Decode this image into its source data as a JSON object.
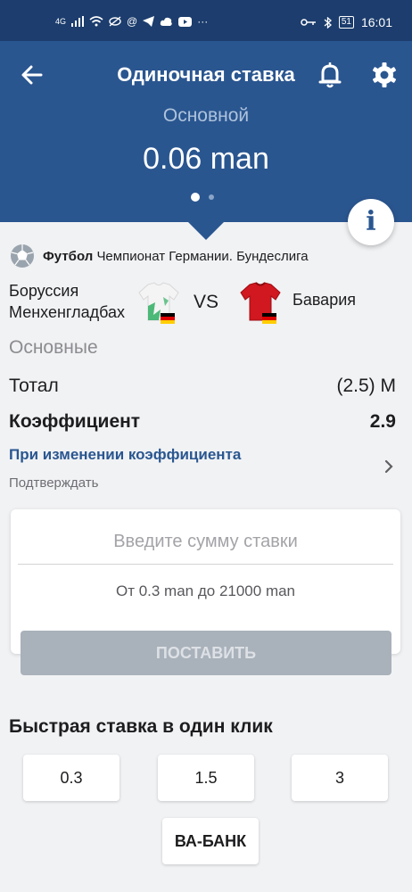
{
  "statusbar": {
    "left_icons": [
      "network-4g-icon",
      "wifi-icon",
      "eye-off-icon",
      "at-icon",
      "telegram-icon",
      "cloud-icon",
      "youtube-icon",
      "more-dots"
    ],
    "network_label": "4G",
    "battery": "51",
    "time": "16:01"
  },
  "header": {
    "title": "Одиночная ставка",
    "subtitle": "Основной",
    "amount": "0.06 man"
  },
  "event": {
    "sport": "Футбол",
    "league": "Чемпионат Германии. Бундеслига",
    "team1": "Боруссия Менхенгладбах",
    "vs": "VS",
    "team2": "Бавария"
  },
  "market": {
    "section": "Основные",
    "total_label": "Тотал",
    "total_value": "(2.5) М",
    "coef_label": "Коэффициент",
    "coef_value": "2.9",
    "odds_change_title": "При изменении коэффициента",
    "odds_change_value": "Подтверждать"
  },
  "stake": {
    "placeholder": "Введите сумму ставки",
    "range": "От 0.3 man до 21000 man",
    "place_label": "ПОСТАВИТЬ"
  },
  "quick": {
    "title": "Быстрая ставка в один клик",
    "options": [
      "0.3",
      "1.5",
      "3"
    ],
    "all_in": "ВА-БАНК"
  },
  "colors": {
    "header_bg": "#2a5690",
    "statusbar_bg": "#1c3d6d",
    "accent": "#2a5690",
    "disabled_button": "#a9b1ba"
  }
}
